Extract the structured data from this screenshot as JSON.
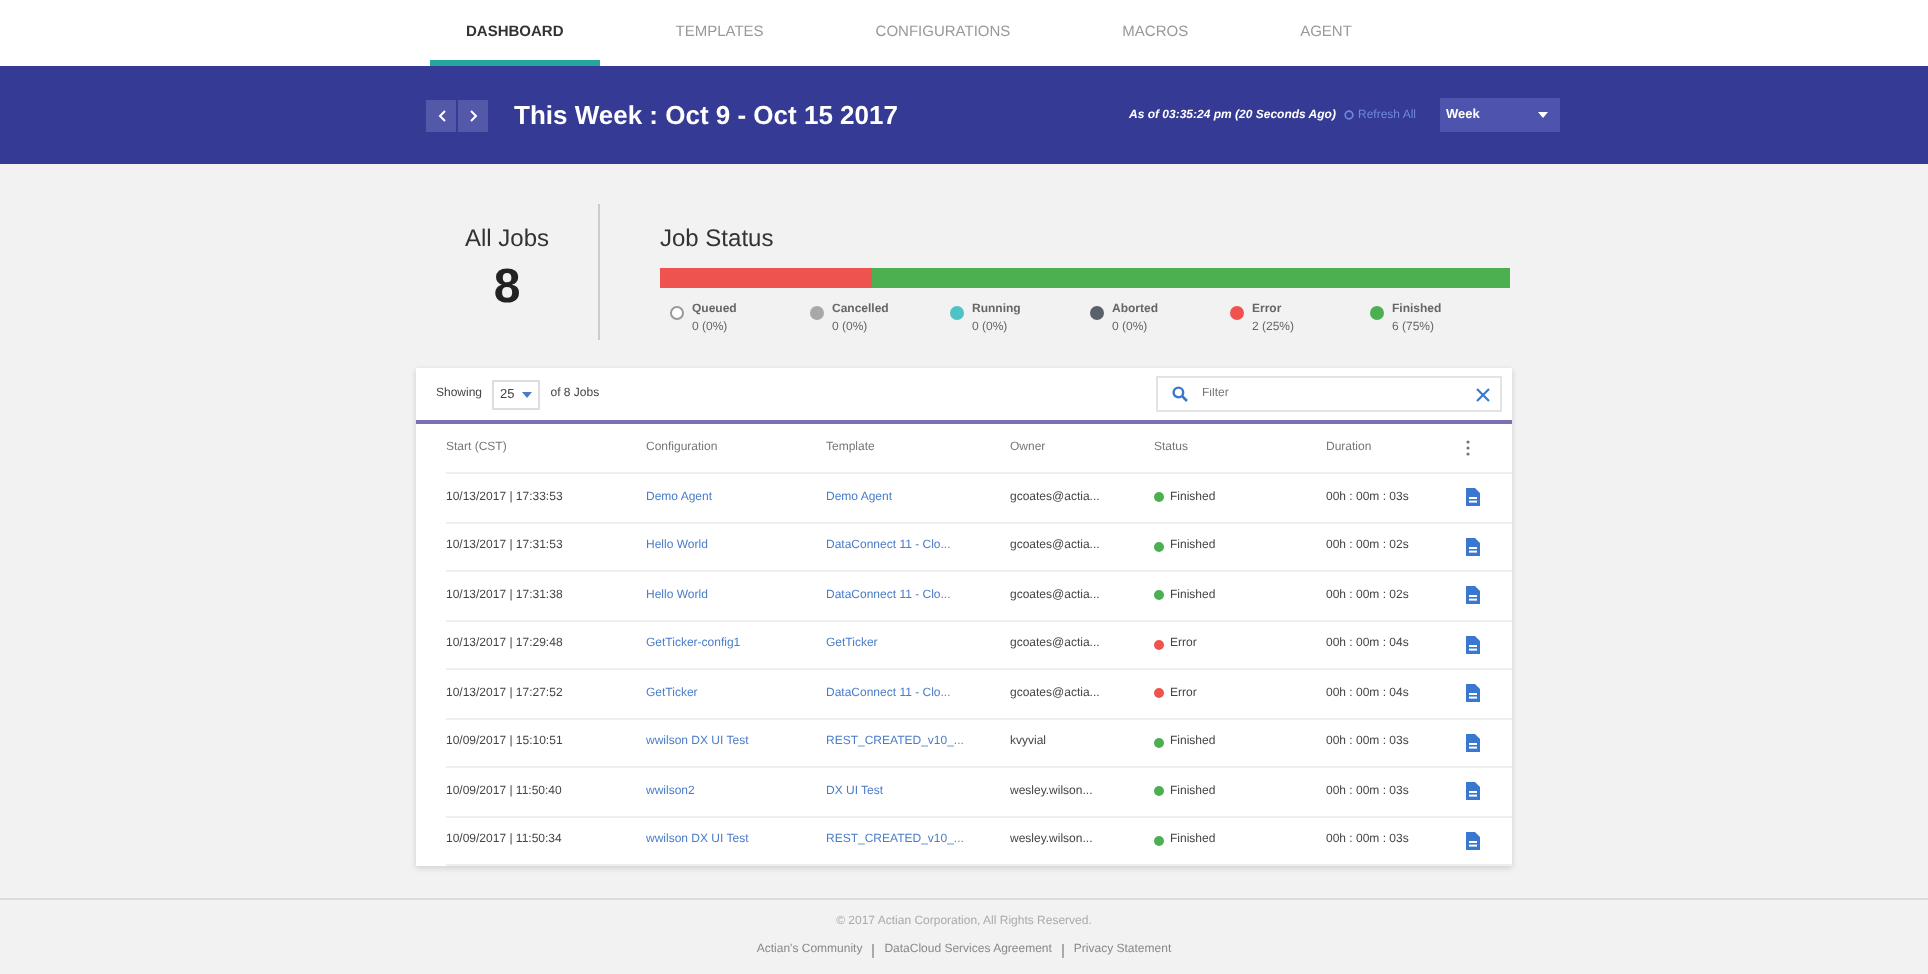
{
  "tabs": [
    {
      "label": "DASHBOARD",
      "selected": true
    },
    {
      "label": "TEMPLATES",
      "selected": false
    },
    {
      "label": "CONFIGURATIONS",
      "selected": false
    },
    {
      "label": "MACROS",
      "selected": false
    },
    {
      "label": "AGENT",
      "selected": false
    }
  ],
  "header": {
    "title": "This Week : Oct 9 - Oct 15 2017",
    "as_of": "As of 03:35:24 pm (20 Seconds Ago)",
    "refresh": "Refresh All",
    "period": "Week"
  },
  "summary": {
    "label": "All Jobs",
    "count": "8"
  },
  "job_status": {
    "title": "Job Status",
    "bar_segments": [
      {
        "level": 0.25,
        "color": "#ef5350"
      },
      {
        "level": 0.75,
        "color": "#4caf50"
      }
    ],
    "items": [
      {
        "label": "Queued",
        "value": "0 (0%)",
        "color": "#ffffff"
      },
      {
        "label": "Cancelled",
        "value": "0 (0%)",
        "color": "#a8a8a8"
      },
      {
        "label": "Running",
        "value": "0 (0%)",
        "color": "#4fc3c3"
      },
      {
        "label": "Aborted",
        "value": "0 (0%)",
        "color": "#5a6168"
      },
      {
        "label": "Error",
        "value": "2 (25%)",
        "color": "#ef5350"
      },
      {
        "label": "Finished",
        "value": "6 (75%)",
        "color": "#4caf50"
      }
    ]
  },
  "table": {
    "showing": "Showing",
    "page_size": "25",
    "of_jobs": "of 8 Jobs",
    "filter_placeholder": "Filter",
    "columns": [
      "Start (CST)",
      "Configuration",
      "Template",
      "Owner",
      "Status",
      "Duration"
    ],
    "rows": [
      {
        "start": "10/13/2017 | 17:33:53",
        "configuration": "Demo Agent",
        "template": "Demo Agent",
        "owner": "gcoates@actia...",
        "status": "Finished",
        "color": "#4caf50",
        "duration": "00h : 00m : 03s"
      },
      {
        "start": "10/13/2017 | 17:31:53",
        "configuration": "Hello World",
        "template": "DataConnect 11 - Clo...",
        "owner": "gcoates@actia...",
        "status": "Finished",
        "color": "#4caf50",
        "duration": "00h : 00m : 02s"
      },
      {
        "start": "10/13/2017 | 17:31:38",
        "configuration": "Hello World",
        "template": "DataConnect 11 - Clo...",
        "owner": "gcoates@actia...",
        "status": "Finished",
        "color": "#4caf50",
        "duration": "00h : 00m : 02s"
      },
      {
        "start": "10/13/2017 | 17:29:48",
        "configuration": "GetTicker-config1",
        "template": "GetTicker",
        "owner": "gcoates@actia...",
        "status": "Error",
        "color": "#ef5350",
        "duration": "00h : 00m : 04s"
      },
      {
        "start": "10/13/2017 | 17:27:52",
        "configuration": "GetTicker",
        "template": "DataConnect 11 - Clo...",
        "owner": "gcoates@actia...",
        "status": "Error",
        "color": "#ef5350",
        "duration": "00h : 00m : 04s"
      },
      {
        "start": "10/09/2017 | 15:10:51",
        "configuration": "wwilson DX UI Test",
        "template": "REST_CREATED_v10_...",
        "owner": "kvyvial",
        "status": "Finished",
        "color": "#4caf50",
        "duration": "00h : 00m : 03s"
      },
      {
        "start": "10/09/2017 | 11:50:40",
        "configuration": "wwilson2",
        "template": "DX UI Test",
        "owner": "wesley.wilson...",
        "status": "Finished",
        "color": "#4caf50",
        "duration": "00h : 00m : 03s"
      },
      {
        "start": "10/09/2017 | 11:50:34",
        "configuration": "wwilson DX UI Test",
        "template": "REST_CREATED_v10_...",
        "owner": "wesley.wilson...",
        "status": "Finished",
        "color": "#4caf50",
        "duration": "00h : 00m : 03s"
      }
    ]
  },
  "footer": {
    "copyright": "© 2017 Actian Corporation, All Rights Reserved.",
    "links": [
      "Actian's Community",
      "DataCloud Services Agreement",
      "Privacy Statement"
    ]
  }
}
